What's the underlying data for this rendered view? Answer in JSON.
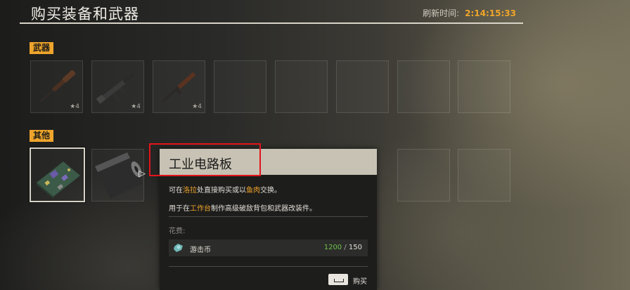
{
  "header": {
    "title": "购买装备和武器",
    "refresh_label": "刷新时间:",
    "refresh_time": "2:14:15:33"
  },
  "sections": {
    "weapons_label": "武器",
    "others_label": "其他"
  },
  "weapons": [
    {
      "icon": "shotgun-icon",
      "stars": "★4"
    },
    {
      "icon": "submachine-gun-icon",
      "stars": "★4"
    },
    {
      "icon": "rifle-icon",
      "stars": "★4"
    }
  ],
  "others": [
    {
      "icon": "circuit-board-icon"
    },
    {
      "icon": "metal-roll-icon"
    }
  ],
  "tooltip": {
    "item_name": "工业电路板",
    "line1": {
      "t1": "可在",
      "h1": "洛拉",
      "t2": "处直接购买或以",
      "h2": "鱼肉",
      "t3": "交换。"
    },
    "line2": {
      "t1": "用于在",
      "h1": "工作台",
      "t2": "制作高级破敌背包和武器改装件。"
    },
    "cost_label": "花费:",
    "currency_name": "游击币",
    "currency_icon": "gem-coin-icon",
    "have": "1200",
    "sep": " / ",
    "need": "150",
    "buy_key_icon": "spacebar-key-icon",
    "buy_label": "购买"
  },
  "colors": {
    "accent": "#eda42b",
    "highlight_box": "#e3141b",
    "have_enough": "#6cc24a"
  }
}
